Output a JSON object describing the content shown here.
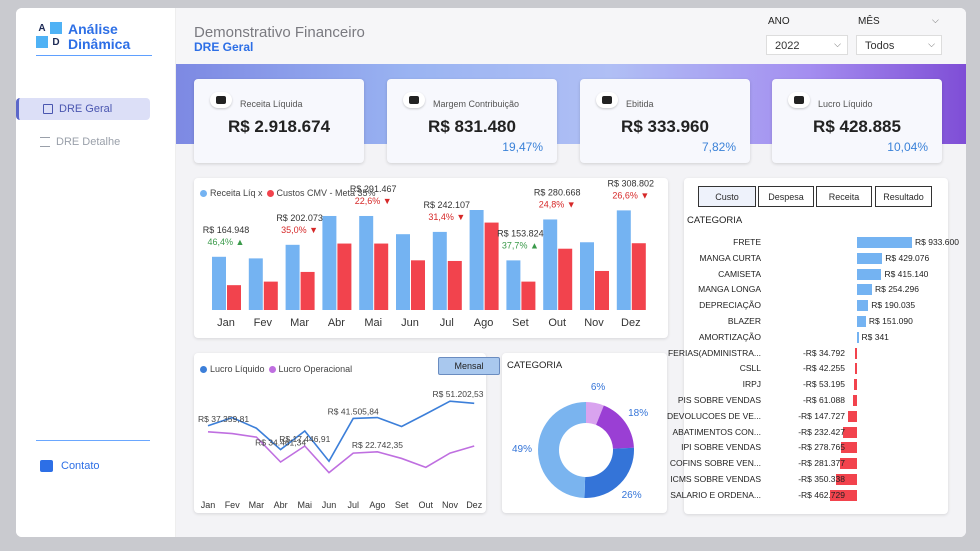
{
  "brand": {
    "line1": "Análise",
    "line2": "Dinâmica",
    "mark": [
      "A",
      "",
      "",
      "D"
    ]
  },
  "sidebar": {
    "items": [
      {
        "label": "DRE Geral",
        "active": true
      },
      {
        "label": "DRE Detalhe",
        "active": false
      }
    ],
    "contato": "Contato"
  },
  "header": {
    "title": "Demonstrativo Financeiro",
    "subtitle": "DRE Geral"
  },
  "filters": {
    "ano": {
      "label": "ANO",
      "value": "2022"
    },
    "mes": {
      "label": "MÊS",
      "value": "Todos"
    }
  },
  "kpis": [
    {
      "label": "Receita Líquida",
      "value": "R$ 2.918.674",
      "pct": ""
    },
    {
      "label": "Margem Contribuição",
      "value": "R$ 831.480",
      "pct": "19,47%"
    },
    {
      "label": "Ebitida",
      "value": "R$ 333.960",
      "pct": "7,82%"
    },
    {
      "label": "Lucro Líquido",
      "value": "R$ 428.885",
      "pct": "10,04%"
    }
  ],
  "colors": {
    "receita": "#74b3f2",
    "custos": "#f2434d",
    "lucro_liquido": "#3c7fd9",
    "lucro_operacional": "#bf6fe0",
    "accent": "#2d6fe6"
  },
  "chart_data": [
    {
      "type": "bar",
      "legend": [
        "Receita Líq x",
        "Custos CMV - Meta 35%"
      ],
      "categories": [
        "Jan",
        "Fev",
        "Mar",
        "Abr",
        "Mai",
        "Jun",
        "Jul",
        "Ago",
        "Set",
        "Out",
        "Nov",
        "Dez"
      ],
      "series": [
        {
          "name": "Receita Líq x",
          "values": [
            164948,
            160000,
            202073,
            291467,
            291467,
            235000,
            242107,
            310000,
            153824,
            280668,
            210000,
            308802
          ]
        },
        {
          "name": "Custos CMV - Meta 35%",
          "values": [
            77000,
            88000,
            118000,
            206000,
            206000,
            154000,
            152000,
            271000,
            88000,
            190000,
            121000,
            207000
          ]
        }
      ],
      "annotations": [
        {
          "month": "Jan",
          "value": "R$ 164.948",
          "pct": "46,4%",
          "dir": "up"
        },
        {
          "month": "Mar",
          "value": "R$ 202.073",
          "pct": "35,0%",
          "dir": "down"
        },
        {
          "month": "Mai",
          "value": "R$ 291.467",
          "pct": "22,6%",
          "dir": "down"
        },
        {
          "month": "Jul",
          "value": "R$ 242.107",
          "pct": "31,4%",
          "dir": "down"
        },
        {
          "month": "Set",
          "value": "R$ 153.824",
          "pct": "37,7%",
          "dir": "up"
        },
        {
          "month": "Out",
          "value": "R$ 280.668",
          "pct": "24,8%",
          "dir": "down"
        },
        {
          "month": "Dez",
          "value": "R$ 308.802",
          "pct": "26,6%",
          "dir": "down"
        }
      ]
    },
    {
      "type": "line",
      "legend": [
        "Lucro Líquido",
        "Lucro Operacional"
      ],
      "button": "Mensal",
      "categories": [
        "Jan",
        "Fev",
        "Mar",
        "Abr",
        "Mai",
        "Jun",
        "Jul",
        "Ago",
        "Set",
        "Out",
        "Nov",
        "Dez"
      ],
      "series": [
        {
          "name": "Lucro Líquido",
          "values": [
            37359.81,
            42000,
            36000,
            24000,
            34461.34,
            17446.91,
            41505.84,
            42000,
            37000,
            44000,
            51202.53,
            50000
          ]
        },
        {
          "name": "Lucro Operacional",
          "values": [
            34000,
            33000,
            31000,
            17000,
            26000,
            11000,
            22000,
            22742.35,
            19000,
            14000,
            22000,
            26000
          ]
        }
      ],
      "labels": [
        {
          "month": "Jan",
          "text": "R$ 37.359,81"
        },
        {
          "month": "Abr",
          "text": "R$ 34.461,34"
        },
        {
          "month": "Mai",
          "text": "R$ 17.446,91"
        },
        {
          "month": "Jul",
          "text": "R$ 41.505,84"
        },
        {
          "month": "Ago",
          "text": "R$ 22.742,35"
        },
        {
          "month": "Nov",
          "text": "R$ 51.202,53"
        }
      ]
    },
    {
      "type": "pie",
      "title": "CATEGORIA",
      "values": [
        6,
        18,
        26,
        49
      ],
      "labels": [
        "6%",
        "18%",
        "26%",
        "49%"
      ],
      "colors": [
        "#d9a3ef",
        "#9a3fd4",
        "#3474d8",
        "#7ab4ef"
      ]
    },
    {
      "type": "bar",
      "title": "CATEGORIA",
      "tabs": [
        "Custo",
        "Despesa",
        "Receita",
        "Resultado"
      ],
      "rows": [
        {
          "name": "FRETE",
          "value": 933600,
          "label": "R$ 933.600"
        },
        {
          "name": "MANGA CURTA",
          "value": 429076,
          "label": "R$ 429.076"
        },
        {
          "name": "CAMISETA",
          "value": 415140,
          "label": "R$ 415.140"
        },
        {
          "name": "MANGA LONGA",
          "value": 254296,
          "label": "R$ 254.296"
        },
        {
          "name": "DEPRECIAÇÃO",
          "value": 190035,
          "label": "R$ 190.035"
        },
        {
          "name": "BLAZER",
          "value": 151090,
          "label": "R$ 151.090"
        },
        {
          "name": "AMORTIZAÇÃO",
          "value": 341,
          "label": "R$ 341"
        },
        {
          "name": "FERIAS(ADMINISTRA...",
          "value": -34792,
          "label": "-R$ 34.792"
        },
        {
          "name": "CSLL",
          "value": -42255,
          "label": "-R$ 42.255"
        },
        {
          "name": "IRPJ",
          "value": -53195,
          "label": "-R$ 53.195"
        },
        {
          "name": "PIS SOBRE VENDAS",
          "value": -61088,
          "label": "-R$ 61.088"
        },
        {
          "name": "DEVOLUCOES DE VE...",
          "value": -147727,
          "label": "-R$ 147.727"
        },
        {
          "name": "ABATIMENTOS CON...",
          "value": -232427,
          "label": "-R$ 232.427"
        },
        {
          "name": "IPI SOBRE VENDAS",
          "value": -278765,
          "label": "-R$ 278.765"
        },
        {
          "name": "COFINS SOBRE VEN...",
          "value": -281377,
          "label": "-R$ 281.377"
        },
        {
          "name": "ICMS SOBRE VENDAS",
          "value": -350338,
          "label": "-R$ 350.338"
        },
        {
          "name": "SALARIO E ORDENA...",
          "value": -462729,
          "label": "-R$ 462.729"
        }
      ]
    }
  ]
}
